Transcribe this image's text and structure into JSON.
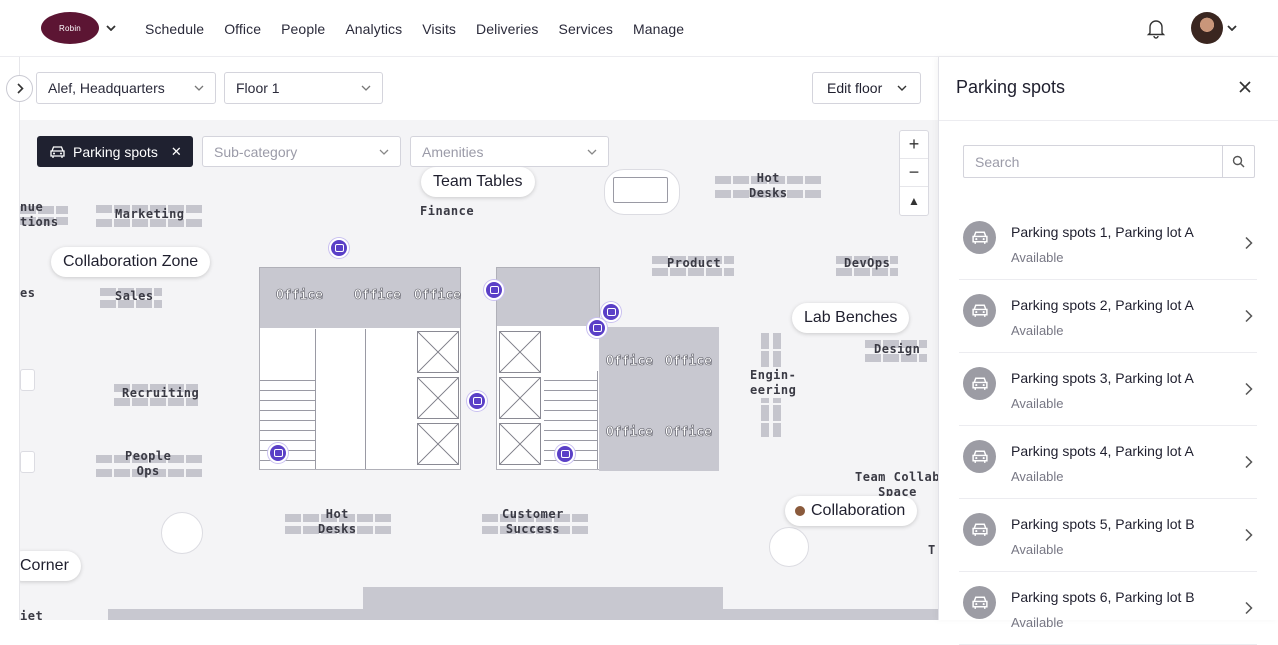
{
  "app": {
    "logo_text": "Robin"
  },
  "nav": {
    "items": [
      {
        "label": "Schedule",
        "name": "nav-item-schedule"
      },
      {
        "label": "Office",
        "name": "nav-item-office"
      },
      {
        "label": "People",
        "name": "nav-item-people"
      },
      {
        "label": "Analytics",
        "name": "nav-item-analytics"
      },
      {
        "label": "Visits",
        "name": "nav-item-visits"
      },
      {
        "label": "Deliveries",
        "name": "nav-item-deliveries"
      },
      {
        "label": "Services",
        "name": "nav-item-services"
      },
      {
        "label": "Manage",
        "name": "nav-item-manage"
      }
    ]
  },
  "filters": {
    "building": "Alef, Headquarters",
    "floor": "Floor 1",
    "edit_floor": "Edit floor",
    "category_chip": "Parking spots",
    "subcategory_placeholder": "Sub-category",
    "amenities_placeholder": "Amenities"
  },
  "zoom": {
    "in": "+",
    "out": "−",
    "reset": "▲"
  },
  "map": {
    "bubbles": {
      "team_tables": "Team Tables",
      "collaboration_zone": "Collaboration Zone",
      "lab_benches": "Lab Benches",
      "collaboration": "Collaboration",
      "corner": "Corner"
    },
    "labels": {
      "venue": "nue\ntions",
      "marketing": "Marketing",
      "finance": "Finance",
      "hot_desks_top": "Hot\nDesks",
      "product": "Product",
      "devops": "DevOps",
      "sales": "Sales",
      "design": "Design",
      "recruiting": "Recruiting",
      "engineering": "Engin-\neering",
      "people_ops": "People\nOps",
      "team_collab": "Team Collab\nSpace",
      "hot_desks_bottom": "Hot\nDesks",
      "customer_success": "Customer\nSuccess",
      "office": "Office",
      "es": "es",
      "iet": "iet",
      "t": "T"
    }
  },
  "panel": {
    "title": "Parking spots",
    "search_placeholder": "Search",
    "items": [
      {
        "title": "Parking spots 1, Parking lot A",
        "status": "Available"
      },
      {
        "title": "Parking spots 2, Parking lot A",
        "status": "Available"
      },
      {
        "title": "Parking spots 3, Parking lot A",
        "status": "Available"
      },
      {
        "title": "Parking spots 4, Parking lot A",
        "status": "Available"
      },
      {
        "title": "Parking spots 5, Parking lot B",
        "status": "Available"
      },
      {
        "title": "Parking spots 6, Parking lot B",
        "status": "Available"
      }
    ]
  },
  "colors": {
    "brand": "#5c1533",
    "accent_pin": "#5a3fc7",
    "chip_bg": "#1f2130"
  }
}
